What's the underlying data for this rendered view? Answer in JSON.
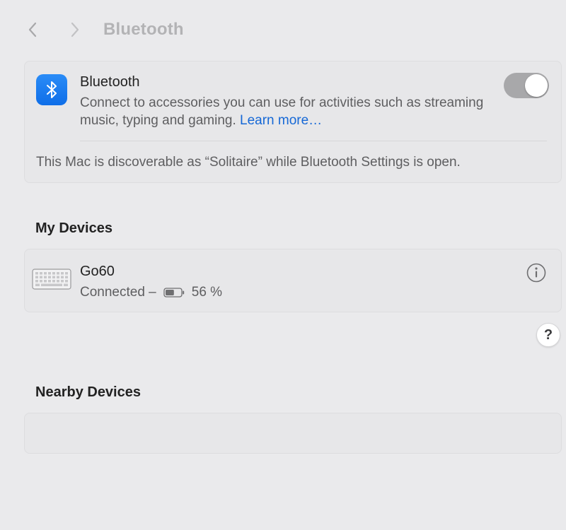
{
  "toolbar": {
    "title": "Bluetooth",
    "back_icon": "chevron-left-icon",
    "forward_icon": "chevron-right-icon"
  },
  "bluetooth": {
    "icon": "bluetooth-icon",
    "title": "Bluetooth",
    "description": "Connect to accessories you can use for activities such as streaming music, typing and gaming.",
    "learn_more": "Learn more…",
    "toggle_on": true,
    "discoverable_text": "This Mac is discoverable as “Solitaire” while Bluetooth Settings is open."
  },
  "my_devices": {
    "heading": "My Devices",
    "devices": [
      {
        "icon": "keyboard-icon",
        "name": "Go60",
        "status": "Connected –",
        "battery_icon": "battery-icon",
        "battery": "56 %",
        "battery_level": 0.56,
        "info_icon": "info-icon"
      }
    ]
  },
  "help": {
    "label": "?"
  },
  "nearby_devices": {
    "heading": "Nearby Devices",
    "devices": []
  },
  "colors": {
    "background": "#eaeaec",
    "accent": "#1668d6",
    "bluetooth_icon": "#1a7ef0",
    "toggle": "#a8a8aa"
  }
}
